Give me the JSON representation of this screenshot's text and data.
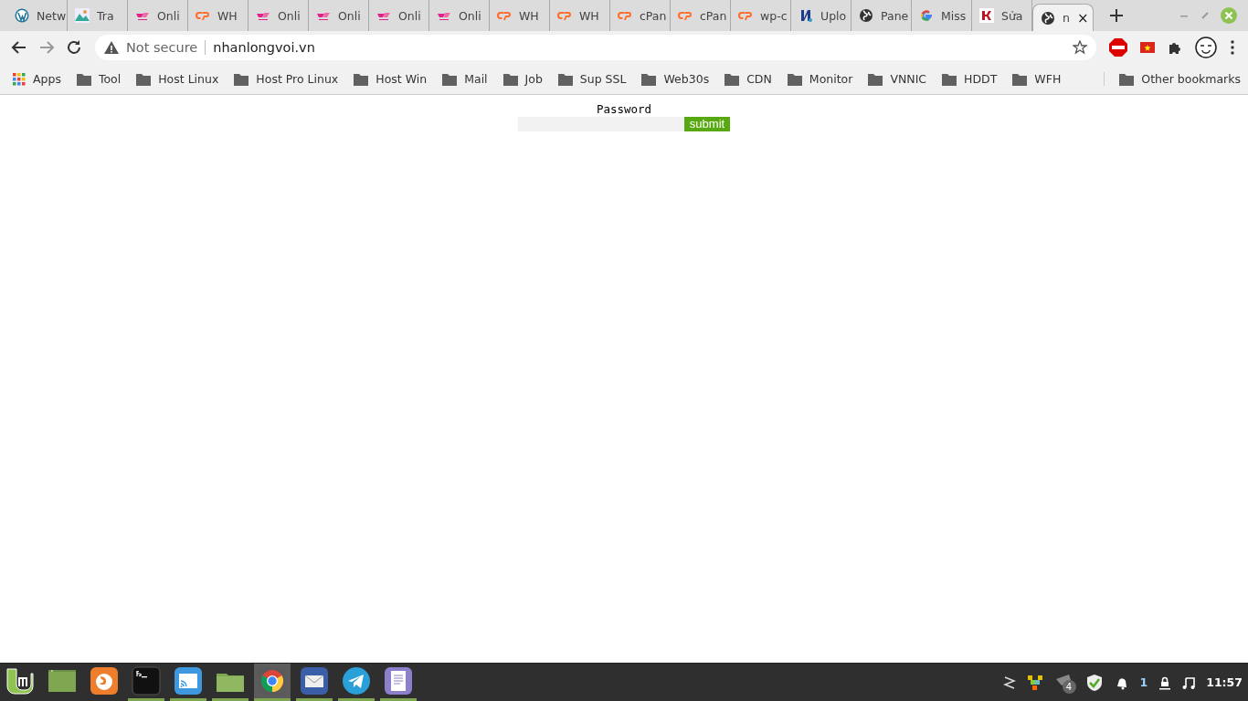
{
  "tabs": [
    {
      "kind": "wordpress",
      "title": "Netw",
      "selected": false
    },
    {
      "kind": "image",
      "title": "Tra",
      "selected": false
    },
    {
      "kind": "pink",
      "title": "Onli",
      "selected": false
    },
    {
      "kind": "cpanel",
      "title": "WH",
      "selected": false
    },
    {
      "kind": "pink",
      "title": "Onli",
      "selected": false
    },
    {
      "kind": "pink",
      "title": "Onli",
      "selected": false
    },
    {
      "kind": "pink",
      "title": "Onli",
      "selected": false
    },
    {
      "kind": "pink",
      "title": "Onli",
      "selected": false
    },
    {
      "kind": "cpanel",
      "title": "WH",
      "selected": false
    },
    {
      "kind": "cpanel",
      "title": "WH",
      "selected": false
    },
    {
      "kind": "cpanel",
      "title": "cPan",
      "selected": false
    },
    {
      "kind": "cpanel",
      "title": "cPan",
      "selected": false
    },
    {
      "kind": "cpanel",
      "title": "wp-c",
      "selected": false
    },
    {
      "kind": "upload",
      "title": "Uplo",
      "selected": false
    },
    {
      "kind": "globe",
      "title": "Pane",
      "selected": false
    },
    {
      "kind": "google",
      "title": "Miss",
      "selected": false
    },
    {
      "kind": "red",
      "title": "Sửa",
      "selected": false
    },
    {
      "kind": "globe",
      "title": "n",
      "selected": true,
      "close": "×"
    }
  ],
  "address_bar": {
    "security": "Not secure",
    "url": "nhanlongvoi.vn"
  },
  "bookmarks": [
    {
      "kind": "apps",
      "label": "Apps"
    },
    {
      "kind": "folder",
      "label": "Tool"
    },
    {
      "kind": "folder",
      "label": "Host Linux"
    },
    {
      "kind": "folder",
      "label": "Host Pro Linux"
    },
    {
      "kind": "folder",
      "label": "Host Win"
    },
    {
      "kind": "folder",
      "label": "Mail"
    },
    {
      "kind": "folder",
      "label": "Job"
    },
    {
      "kind": "folder",
      "label": "Sup SSL"
    },
    {
      "kind": "folder",
      "label": "Web30s"
    },
    {
      "kind": "folder",
      "label": "CDN"
    },
    {
      "kind": "folder",
      "label": "Monitor"
    },
    {
      "kind": "folder",
      "label": "VNNIC"
    },
    {
      "kind": "folder",
      "label": "HDDT"
    },
    {
      "kind": "folder",
      "label": "WFH"
    }
  ],
  "other_bookmarks": "Other bookmarks",
  "form": {
    "label": "Password",
    "submit": "submit"
  },
  "taskbar": {
    "apps": [
      {
        "kind": "mint",
        "running": false,
        "selected": false
      },
      {
        "kind": "desktop",
        "running": false,
        "selected": false
      },
      {
        "kind": "firefox",
        "running": false,
        "selected": false
      },
      {
        "kind": "terminal",
        "running": true,
        "selected": false
      },
      {
        "kind": "rss",
        "running": true,
        "selected": false
      },
      {
        "kind": "files",
        "running": true,
        "selected": false
      },
      {
        "kind": "chrome",
        "running": true,
        "selected": true
      },
      {
        "kind": "mail",
        "running": true,
        "selected": false
      },
      {
        "kind": "telegram",
        "running": true,
        "selected": false
      },
      {
        "kind": "notes",
        "running": true,
        "selected": false
      }
    ],
    "updates_count": "4",
    "notifications_count": "1",
    "clock": "11:57"
  }
}
